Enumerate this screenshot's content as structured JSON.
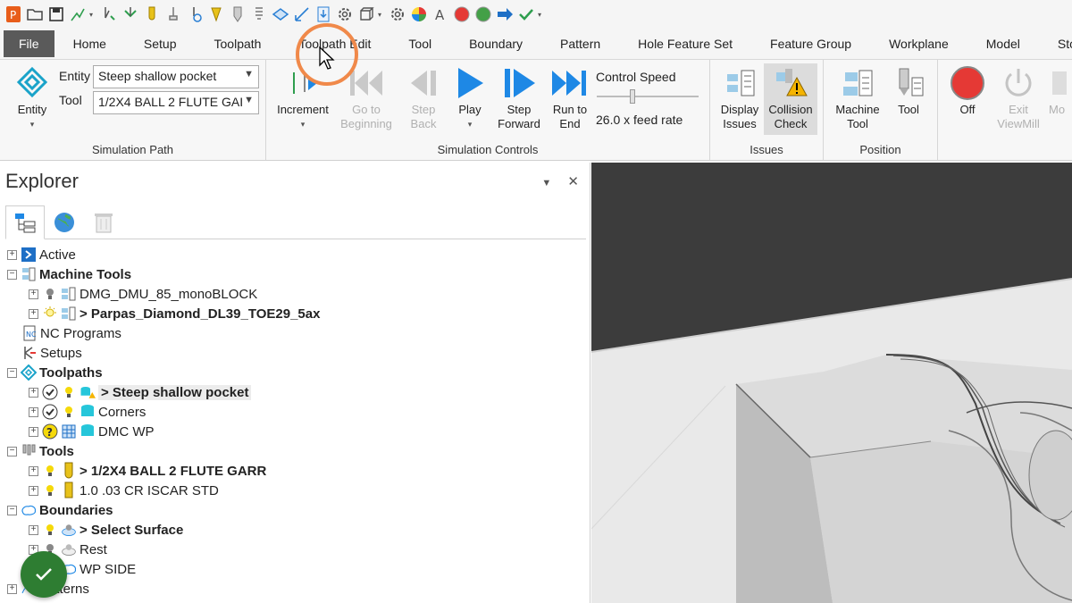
{
  "quick_access": {
    "icons": [
      "powermill-logo-icon",
      "open-folder-icon",
      "save-icon",
      "toolpath-icon",
      "stock-icon",
      "approach-icon",
      "tool-icon",
      "drill-icon",
      "probe-icon",
      "tip-icon",
      "cutter-icon",
      "thread-icon",
      "plane-icon",
      "measure-icon",
      "import-icon",
      "settings-icon",
      "box-icon",
      "gear-icon",
      "color-wheel-icon",
      "font-icon",
      "red-circle-icon",
      "green-circle-icon",
      "arrow-right-icon",
      "check-icon"
    ]
  },
  "tabs": [
    "File",
    "Home",
    "Setup",
    "Toolpath",
    "Toolpath Edit",
    "Tool",
    "Boundary",
    "Pattern",
    "Hole Feature Set",
    "Feature Group",
    "Workplane",
    "Model",
    "Stock Model"
  ],
  "ribbon": {
    "simulation_path": {
      "entity_label": "Entity",
      "entity_big_label": "Entity",
      "entity_value": "Steep shallow pocket",
      "tool_label": "Tool",
      "tool_value": "1/2X4 BALL 2 FLUTE GAI",
      "group_label": "Simulation Path"
    },
    "simulation_controls": {
      "increment": "Increment",
      "go_to_beginning": "Go to Beginning",
      "step_back": "Step Back",
      "play": "Play",
      "step_forward": "Step Forward",
      "run_to_end": "Run to End",
      "control_speed": "Control Speed",
      "feed_rate": "26.0 x feed rate",
      "speed_level": 0.35,
      "group_label": "Simulation Controls"
    },
    "issues": {
      "display_issues": "Display Issues",
      "collision_check": "Collision Check",
      "group_label": "Issues"
    },
    "position": {
      "machine_tool": "Machine Tool",
      "tool": "Tool",
      "group_label": "Position"
    },
    "viewmill": {
      "off": "Off",
      "exit_viewmill": "Exit ViewMill",
      "more": "Mo"
    }
  },
  "explorer": {
    "title": "Explorer",
    "tree": [
      {
        "label": "Active",
        "bold": false
      },
      {
        "label": "Machine Tools",
        "bold": true
      },
      {
        "label": "DMG_DMU_85_monoBLOCK",
        "bold": false
      },
      {
        "label": "> Parpas_Diamond_DL39_TOE29_5ax",
        "bold": true
      },
      {
        "label": "NC Programs",
        "bold": false
      },
      {
        "label": "Setups",
        "bold": false
      },
      {
        "label": "Toolpaths",
        "bold": true
      },
      {
        "label": "> Steep shallow pocket",
        "bold": true
      },
      {
        "label": "Corners",
        "bold": false
      },
      {
        "label": "DMC WP",
        "bold": false
      },
      {
        "label": "Tools",
        "bold": true
      },
      {
        "label": "> 1/2X4 BALL 2 FLUTE GARR",
        "bold": true
      },
      {
        "label": "1.0 .03 CR ISCAR STD",
        "bold": false
      },
      {
        "label": "Boundaries",
        "bold": true
      },
      {
        "label": "> Select Surface",
        "bold": true
      },
      {
        "label": "Rest",
        "bold": false
      },
      {
        "label": "WP SIDE",
        "bold": false
      },
      {
        "label": "Patterns",
        "bold": false
      }
    ]
  },
  "colors": {
    "accent": "#1e88e5",
    "file_tab": "#5a5a5a",
    "viewport_bg": "#3c3c3c",
    "fab": "#2e7d32",
    "highlight_ring": "#f0894a"
  }
}
